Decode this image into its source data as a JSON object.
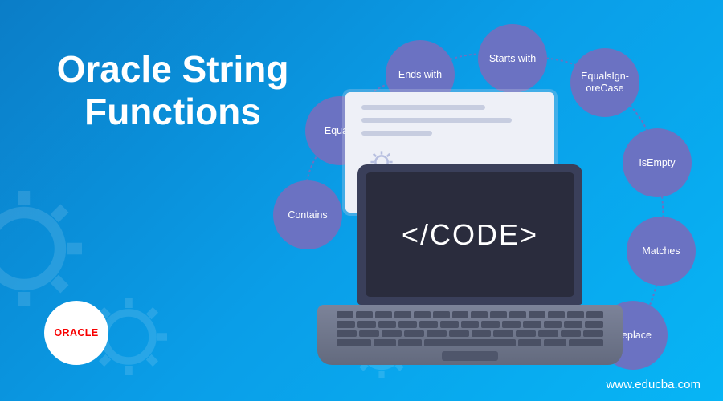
{
  "title_line1": "Oracle String",
  "title_line2": "Functions",
  "logo": "ORACLE",
  "url": "www.educba.com",
  "code_label": "</CODE>",
  "bubbles": {
    "contains": "Contains",
    "equals": "Equals",
    "endswith": "Ends with",
    "startswith": "Starts with",
    "equalsignorecase": "EqualsIgn-\noreCase",
    "isempty": "IsEmpty",
    "matches": "Matches",
    "replace": "Replace"
  }
}
